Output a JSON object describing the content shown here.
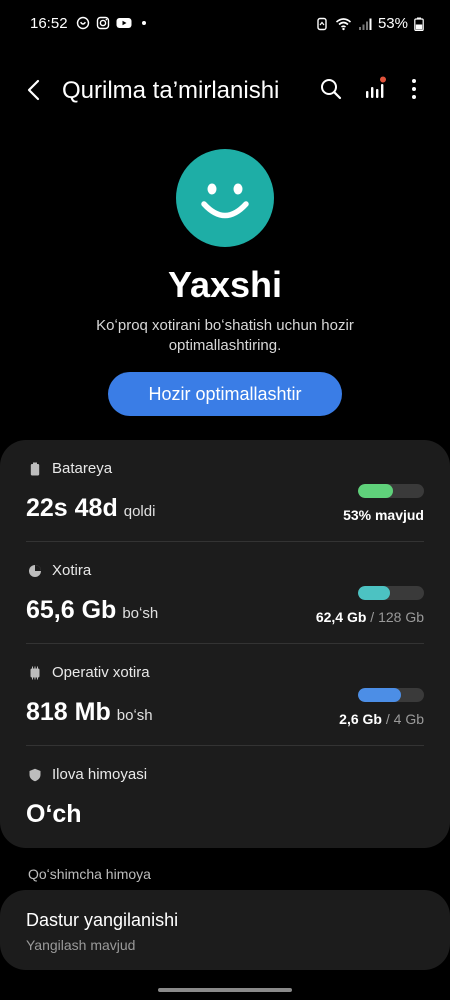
{
  "status_bar": {
    "time": "16:52",
    "left_icons": [
      "ring-status-icon",
      "instagram-icon",
      "youtube-icon",
      "notification-dot-icon"
    ],
    "right_icons": [
      "data-saver-icon",
      "wifi-icon",
      "signal-icon",
      "battery-icon"
    ],
    "battery_text": "53%"
  },
  "app_bar": {
    "title": "Qurilma ta’mirlanishi",
    "actions": [
      "search-icon",
      "chart-icon",
      "more-icon"
    ]
  },
  "hero": {
    "status": "Yaxshi",
    "description": "Koʻproq xotirani boʻshatish uchun hozir optimallashtiring.",
    "optimize_button": "Hozir optimallashtir",
    "icon_color": "#1eaea6"
  },
  "rows": {
    "battery": {
      "label": "Batareya",
      "value": "22s 48d",
      "unit": "qoldi",
      "detail": "53% mavjud",
      "fill_fraction": 0.53,
      "color": "#5fd17a"
    },
    "storage": {
      "label": "Xotira",
      "value": "65,6 Gb",
      "unit": "boʻsh",
      "detail_used": "62,4 Gb",
      "detail_total": " / 128 Gb",
      "fill_fraction": 0.49,
      "color": "#4cc2c2"
    },
    "memory": {
      "label": "Operativ xotira",
      "value": "818 Mb",
      "unit": "boʻsh",
      "detail_used": "2,6 Gb",
      "detail_total": " / 4 Gb",
      "fill_fraction": 0.65,
      "color": "#4c8ee6"
    },
    "app_protection": {
      "label": "Ilova himoyasi",
      "value": "Oʻch"
    }
  },
  "extra_section": {
    "heading": "Qoʻshimcha himoya",
    "update": {
      "title": "Dastur yangilanishi",
      "subtitle": "Yangilash mavjud"
    }
  },
  "colors": {
    "accent_button": "#3a7de6",
    "card_bg": "#1c1c1c",
    "notification_badge": "#e0533b"
  }
}
